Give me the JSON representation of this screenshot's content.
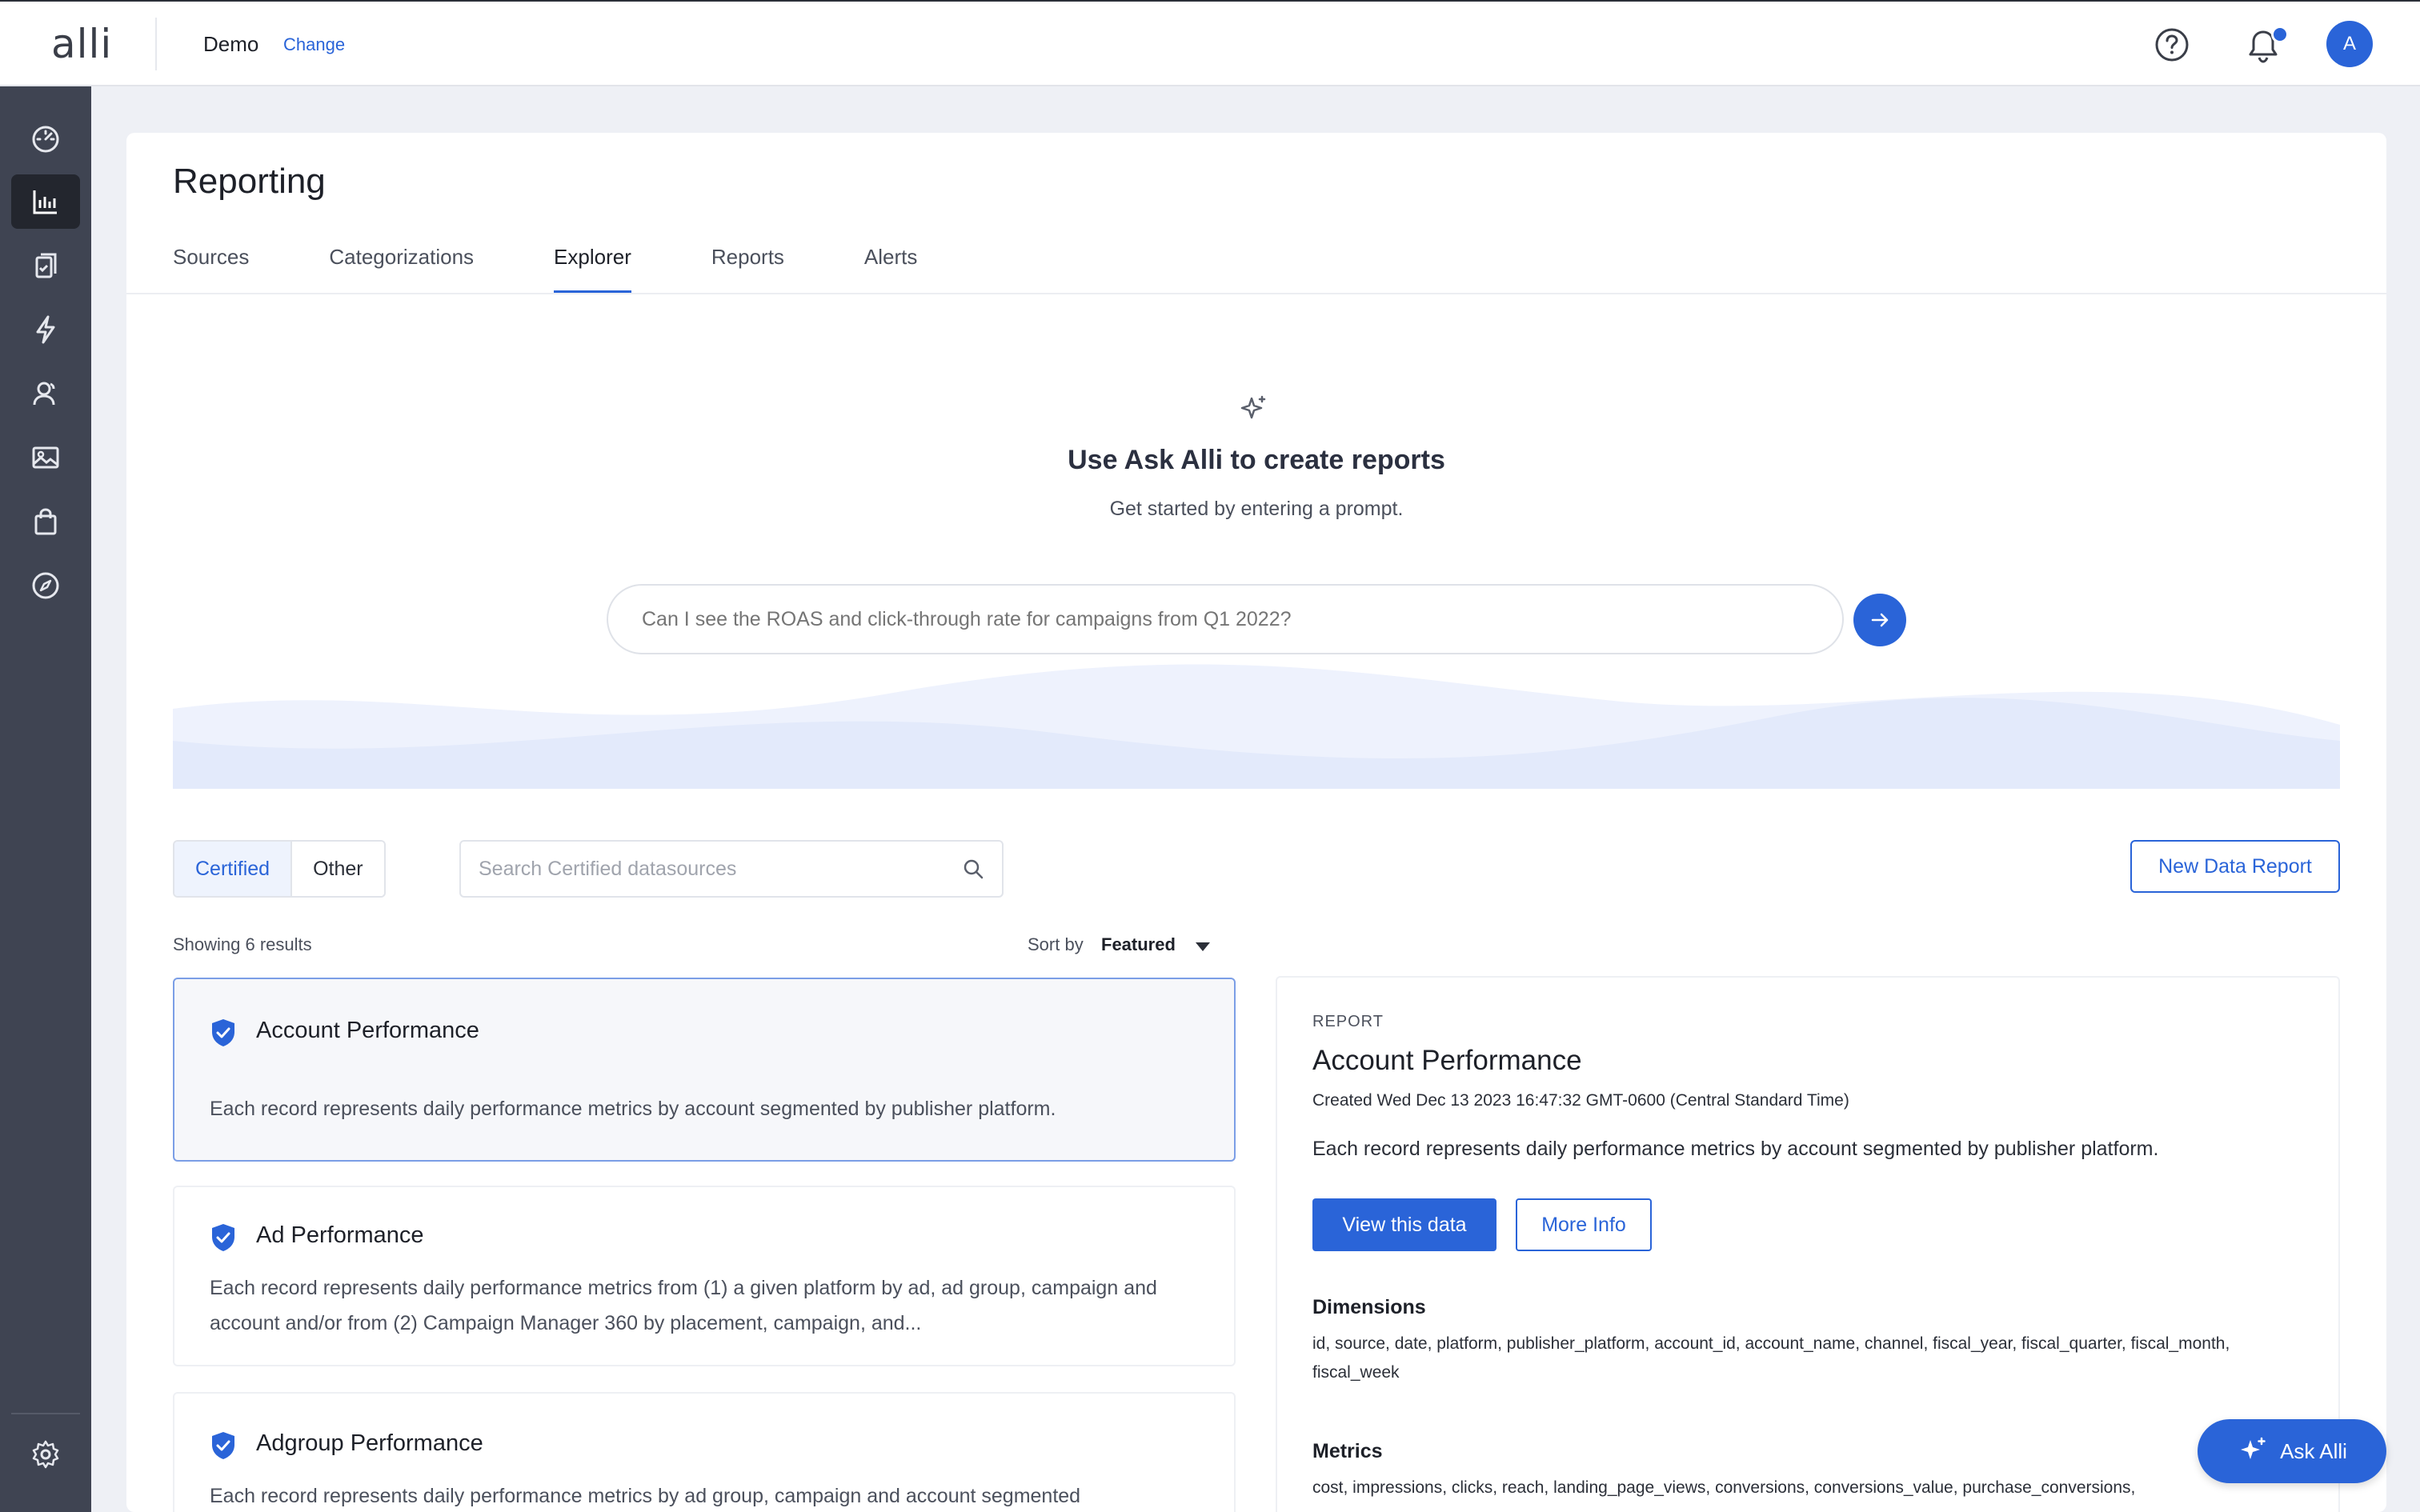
{
  "header": {
    "logo": "alli",
    "org_name": "Demo",
    "change_label": "Change",
    "avatar_initial": "A"
  },
  "sidebar": {
    "items": [
      {
        "icon": "dashboard-icon",
        "active": false
      },
      {
        "icon": "bar-chart-icon",
        "active": true
      },
      {
        "icon": "clipboard-icon",
        "active": false
      },
      {
        "icon": "lightning-icon",
        "active": false
      },
      {
        "icon": "users-icon",
        "active": false
      },
      {
        "icon": "image-icon",
        "active": false
      },
      {
        "icon": "shopping-bag-icon",
        "active": false
      },
      {
        "icon": "compass-icon",
        "active": false
      }
    ],
    "footer_icon": "gear-icon"
  },
  "page": {
    "title": "Reporting",
    "tabs": [
      {
        "label": "Sources",
        "active": false
      },
      {
        "label": "Categorizations",
        "active": false
      },
      {
        "label": "Explorer",
        "active": true
      },
      {
        "label": "Reports",
        "active": false
      },
      {
        "label": "Alerts",
        "active": false
      }
    ]
  },
  "hero": {
    "title": "Use Ask Alli to create reports",
    "subtitle": "Get started by entering a prompt.",
    "prompt_placeholder": "Can I see the ROAS and click-through rate for campaigns from Q1 2022?"
  },
  "filters": {
    "segments": [
      "Certified",
      "Other"
    ],
    "active_segment": "Certified",
    "search_placeholder": "Search Certified datasources",
    "new_report_label": "New Data Report",
    "results_text": "Showing 6 results",
    "sort_label": "Sort by",
    "sort_value": "Featured"
  },
  "datasources": [
    {
      "title": "Account Performance",
      "description": "Each record represents daily performance metrics by account segmented by publisher platform.",
      "selected": true
    },
    {
      "title": "Ad Performance",
      "description": "Each record represents daily performance metrics from (1) a given platform by ad, ad group, campaign and account and/or from (2) Campaign Manager 360 by placement, campaign, and...",
      "selected": false
    },
    {
      "title": "Adgroup Performance",
      "description": "Each record represents daily performance metrics by ad group, campaign and account segmented",
      "selected": false
    }
  ],
  "detail": {
    "kind": "REPORT",
    "title": "Account Performance",
    "created": "Created Wed Dec 13 2023 16:47:32 GMT-0600 (Central Standard Time)",
    "description": "Each record represents daily performance metrics by account segmented by publisher platform.",
    "view_label": "View this data",
    "more_label": "More Info",
    "dimensions_heading": "Dimensions",
    "dimensions": "id, source, date, platform, publisher_platform, account_id, account_name, channel, fiscal_year, fiscal_quarter, fiscal_month, fiscal_week",
    "metrics_heading": "Metrics",
    "metrics": "cost, impressions, clicks, reach, landing_page_views, conversions, conversions_value, purchase_conversions,"
  },
  "ask_button": {
    "label": "Ask Alli"
  },
  "colors": {
    "accent": "#2a64d8",
    "sidebar_bg": "#3f4452",
    "sidebar_active": "#23262e",
    "page_bg": "#eef0f5"
  }
}
